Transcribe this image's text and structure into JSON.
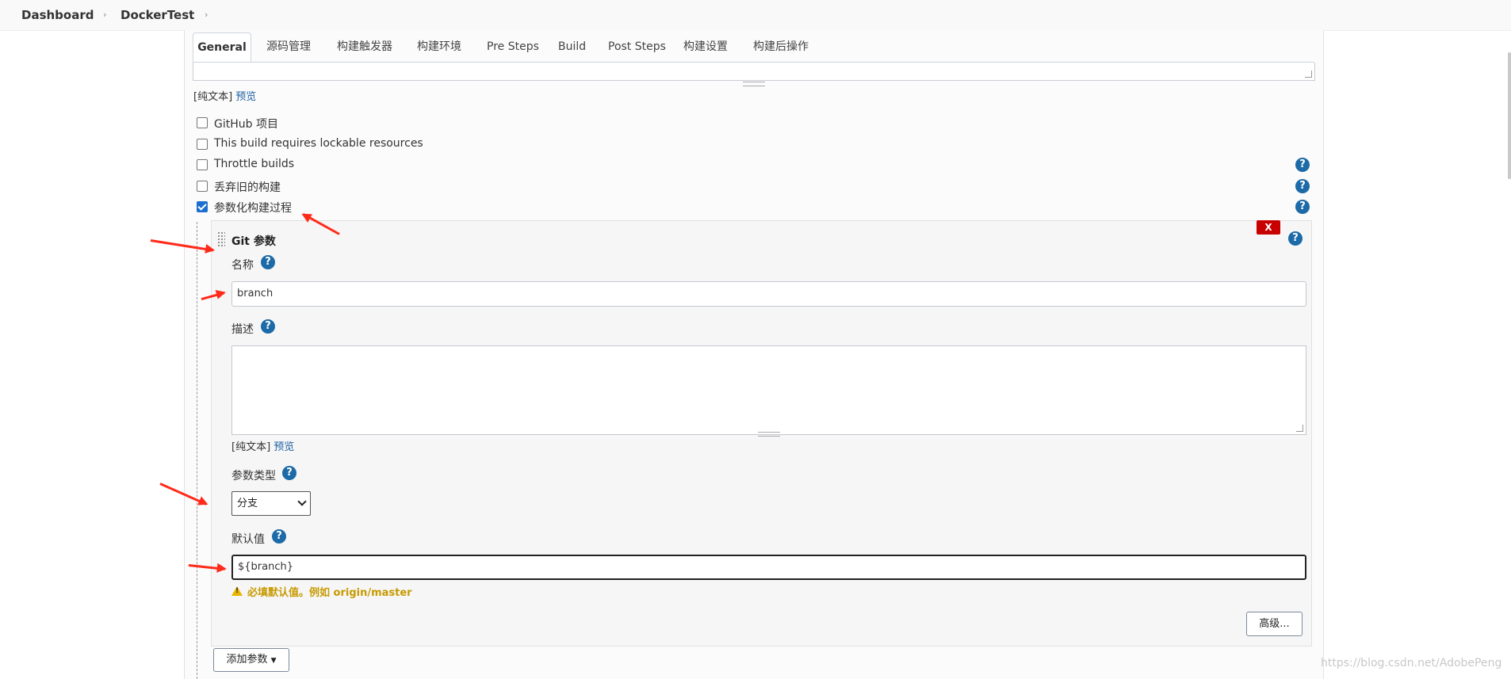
{
  "breadcrumb": {
    "items": [
      "Dashboard",
      "DockerTest"
    ],
    "separator": "›"
  },
  "tabs": [
    "General",
    "源码管理",
    "构建触发器",
    "构建环境",
    "Pre Steps",
    "Build",
    "Post Steps",
    "构建设置",
    "构建后操作"
  ],
  "active_tab": "General",
  "top_description_format": {
    "plain_text": "[纯文本]",
    "preview": "预览"
  },
  "options": [
    {
      "label": "GitHub 项目",
      "checked": false,
      "help": false
    },
    {
      "label": "This build requires lockable resources",
      "checked": false,
      "help": false
    },
    {
      "label": "Throttle builds",
      "checked": false,
      "help": true
    },
    {
      "label": "丢弃旧的构建",
      "checked": false,
      "help": true
    },
    {
      "label": "参数化构建过程",
      "checked": true,
      "help": true
    }
  ],
  "help_glyph": "?",
  "parameter": {
    "title": "Git 参数",
    "delete_label": "X",
    "name_label": "名称",
    "name_value": "branch",
    "description_label": "描述",
    "description_format": {
      "plain_text": "[纯文本]",
      "preview": "预览"
    },
    "type_label": "参数类型",
    "type_value": "分支",
    "default_label": "默认值",
    "default_value": "${branch}",
    "warning": "必填默认值。例如 origin/master",
    "advanced_button": "高级..."
  },
  "add_parameter_button": "添加参数",
  "watermark": "https://blog.csdn.net/AdobePeng",
  "colors": {
    "accent": "#1a6fce",
    "help": "#1c6aa7",
    "delete": "#c80000",
    "warning": "#c79a00",
    "annotation_arrow": "#ff2a1a"
  }
}
